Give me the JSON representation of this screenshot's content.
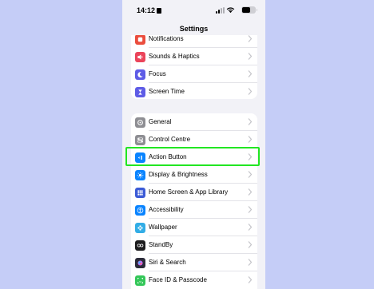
{
  "status_bar": {
    "time": "14:12"
  },
  "header": {
    "title": "Settings"
  },
  "group1": {
    "items": [
      {
        "label": "Notifications",
        "icon": "bell-icon",
        "color": "#eb4d3d"
      },
      {
        "label": "Sounds & Haptics",
        "icon": "speaker-icon",
        "color": "#eb445a"
      },
      {
        "label": "Focus",
        "icon": "moon-icon",
        "color": "#5e5ce6"
      },
      {
        "label": "Screen Time",
        "icon": "hourglass-icon",
        "color": "#5e5ce6"
      }
    ]
  },
  "group2": {
    "items": [
      {
        "label": "General",
        "icon": "gear-icon",
        "color": "#8e8e93"
      },
      {
        "label": "Control Centre",
        "icon": "toggles-icon",
        "color": "#8e8e93"
      },
      {
        "label": "Action Button",
        "icon": "action-button-icon",
        "color": "#0a84ff"
      },
      {
        "label": "Display & Brightness",
        "icon": "sun-icon",
        "color": "#0a84ff"
      },
      {
        "label": "Home Screen & App Library",
        "icon": "grid-icon",
        "color": "#3c5bd6"
      },
      {
        "label": "Accessibility",
        "icon": "accessibility-icon",
        "color": "#0a84ff"
      },
      {
        "label": "Wallpaper",
        "icon": "flower-icon",
        "color": "#32ade6"
      },
      {
        "label": "StandBy",
        "icon": "standby-icon",
        "color": "#1c1c1e"
      },
      {
        "label": "Siri & Search",
        "icon": "siri-icon",
        "color": "#2c2c3a"
      },
      {
        "label": "Face ID & Passcode",
        "icon": "face-id-icon",
        "color": "#34c759"
      }
    ]
  },
  "annotation": {
    "highlight_color": "#22e622"
  }
}
